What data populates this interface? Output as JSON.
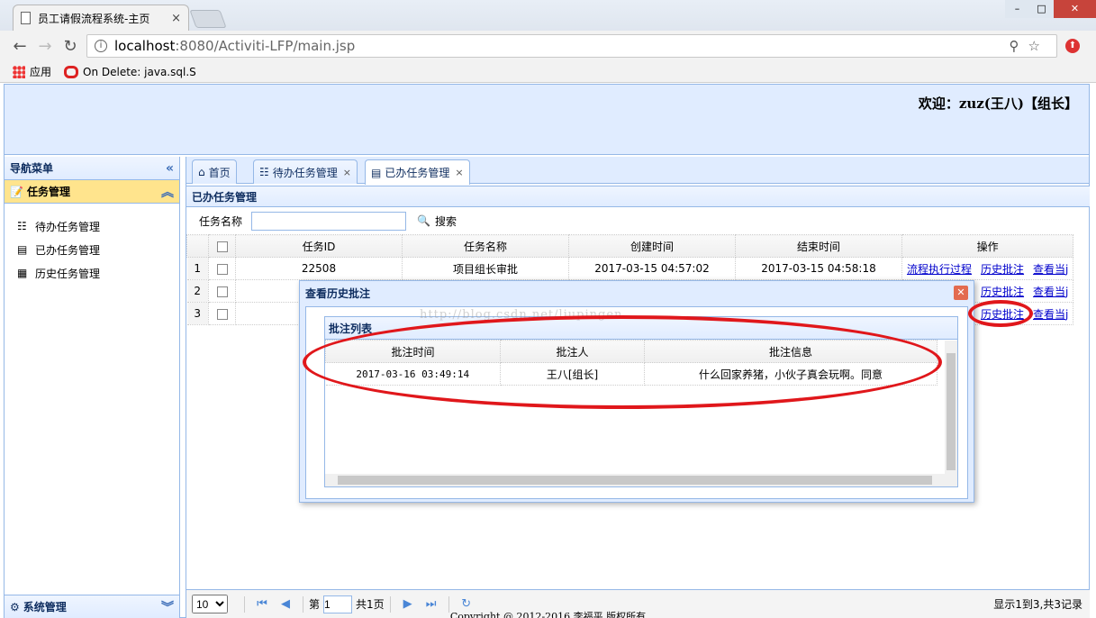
{
  "browser": {
    "tab_title": "员工请假流程系统-主页",
    "tab_close": "×",
    "url_host": "localhost",
    "url_path": ":8080/Activiti-LFP/main.jsp",
    "bookmarks": [
      {
        "label": "应用",
        "icon": "apps-grid-icon"
      },
      {
        "label": "On Delete: java.sql.S",
        "icon": "oracle-icon"
      }
    ]
  },
  "header": {
    "welcome": "欢迎：zuz(王八)【组长】"
  },
  "west": {
    "title": "导航菜单",
    "section": "任务管理",
    "items": [
      {
        "label": "待办任务管理",
        "icon": "todo-list-icon"
      },
      {
        "label": "已办任务管理",
        "icon": "done-doc-icon"
      },
      {
        "label": "历史任务管理",
        "icon": "history-icon"
      }
    ],
    "bottom_section": "系统管理"
  },
  "tabs": [
    {
      "label": "首页",
      "icon": "home-icon",
      "closable": false
    },
    {
      "label": "待办任务管理",
      "icon": "todo-list-icon",
      "closable": true
    },
    {
      "label": "已办任务管理",
      "icon": "done-doc-icon",
      "closable": true
    }
  ],
  "grid": {
    "title": "已办任务管理",
    "search_label": "任务名称",
    "search_value": "",
    "search_button": "搜索",
    "columns": [
      "任务ID",
      "任务名称",
      "创建时间",
      "结束时间",
      "操作"
    ],
    "rows": [
      {
        "num": "1",
        "id": "22508",
        "name": "项目组长审批",
        "created": "2017-03-15 04:57:02",
        "ended": "2017-03-15 04:58:18"
      },
      {
        "num": "2",
        "id": "",
        "name": "",
        "created": "",
        "ended": ""
      },
      {
        "num": "3",
        "id": "",
        "name": "",
        "created": "",
        "ended": ""
      }
    ],
    "actions": {
      "flow": "流程执行过程",
      "history": "历史批注",
      "view": "查看当j"
    }
  },
  "pager": {
    "page_size": "10",
    "page_label_pre": "第",
    "page_value": "1",
    "page_label_post": "共1页",
    "info": "显示1到3,共3记录"
  },
  "dialog": {
    "title": "查看历史批注",
    "panel_title": "批注列表",
    "columns": [
      "批注时间",
      "批注人",
      "批注信息"
    ],
    "rows": [
      {
        "time": "2017-03-16 03:49:14",
        "person": "王八[组长]",
        "message": "什么回家养猪，小伙子真会玩啊。同意"
      }
    ]
  },
  "watermark": "http://blog.csdn.net/liupingen",
  "footer": "Copyright @ 2012-2016 李福平 版权所有",
  "colors": {
    "panel_border": "#95b8e7",
    "panel_header": "#e0ecff",
    "accordion_selected": "#ffe48d",
    "annotation_red": "#e0171b",
    "link": "#0000cc"
  }
}
